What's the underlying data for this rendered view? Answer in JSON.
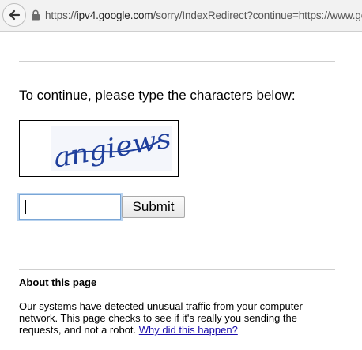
{
  "browser": {
    "url_scheme": "https://",
    "url_host": "ipv4.google.com",
    "url_path": "/sorry/IndexRedirect?continue=https://www.goog",
    "back_icon": "back-arrow-icon",
    "lock_icon": "lock-icon"
  },
  "page": {
    "prompt": "To continue, please type the characters below:",
    "captcha_text": "angiews",
    "captcha_color": "#1f3f9c",
    "input_value": "",
    "submit_label": "Submit",
    "about_heading": "About this page",
    "about_line1": "Our systems have detected unusual traffic from your computer",
    "about_line2": "network. This page checks to see if it's really you sending the",
    "about_line3_prefix": "requests, and not a robot. ",
    "why_link": "Why did this happen?"
  }
}
